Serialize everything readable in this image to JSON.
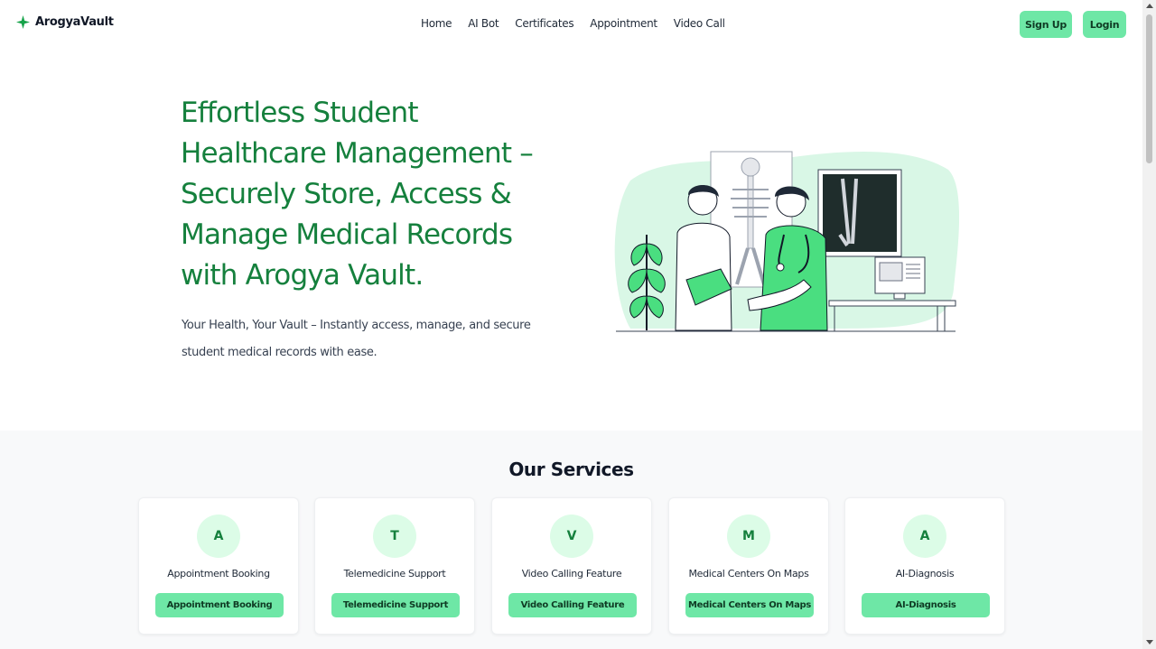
{
  "brand": {
    "name": "ArogyaVault",
    "icon": "sparkle-icon",
    "accent": "#16a34a"
  },
  "nav": {
    "links": [
      "Home",
      "AI Bot",
      "Certificates",
      "Appointment",
      "Video Call"
    ],
    "signup_label": "Sign Up",
    "login_label": "Login"
  },
  "hero": {
    "title": "Effortless Student Healthcare Management – Securely Store, Access & Manage Medical Records with Arogya Vault.",
    "subtitle": "Your Health, Your Vault – Instantly access, manage, and secure student medical records with ease.",
    "illustration": "doctor-patient-xray-illustration"
  },
  "services": {
    "title": "Our Services",
    "cards": [
      {
        "letter": "A",
        "name": "Appointment Booking",
        "button": "Appointment Booking"
      },
      {
        "letter": "T",
        "name": "Telemedicine Support",
        "button": "Telemedicine Support"
      },
      {
        "letter": "V",
        "name": "Video Calling Feature",
        "button": "Video Calling Feature"
      },
      {
        "letter": "M",
        "name": "Medical Centers On Maps",
        "button": "Medical Centers On Maps"
      },
      {
        "letter": "A",
        "name": "AI-Diagnosis",
        "button": "AI-Diagnosis"
      }
    ]
  },
  "colors": {
    "primary_button": "#6ee7a6",
    "heading_green": "#15803d",
    "section_bg": "#f8f9fa"
  }
}
